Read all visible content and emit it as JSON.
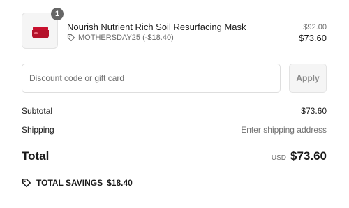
{
  "cart_item": {
    "quantity": "1",
    "name": "Nourish Nutrient Rich Soil Resurfacing Mask",
    "discount_label": "MOTHERSDAY25 (-$18.40)",
    "original_price": "$92.00",
    "price": "$73.60",
    "thumbnail_icon": "product-jar-icon",
    "discount_icon": "tag-icon"
  },
  "discount_form": {
    "placeholder": "Discount code or gift card",
    "value": "",
    "apply_label": "Apply"
  },
  "summary": {
    "subtotal_label": "Subtotal",
    "subtotal_value": "$73.60",
    "shipping_label": "Shipping",
    "shipping_value": "Enter shipping address",
    "total_label": "Total",
    "total_currency": "USD",
    "total_value": "$73.60"
  },
  "savings": {
    "label": "TOTAL SAVINGS",
    "amount": "$18.40",
    "icon": "tag-icon"
  },
  "colors": {
    "badge": "#666666",
    "product_red": "#c8102e",
    "muted_text": "#707070"
  }
}
